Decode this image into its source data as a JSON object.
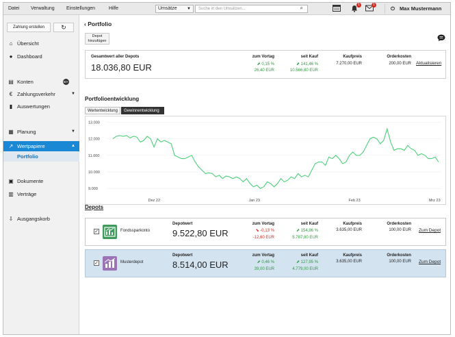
{
  "menubar": {
    "items": [
      "Datei",
      "Verwaltung",
      "Einstellungen",
      "Hilfe"
    ],
    "search_select": "Umsätze",
    "search_placeholder": "Suche in den Umsätzen...",
    "notifications_count": "1",
    "messages_count": "1",
    "user_name": "Max Mustermann"
  },
  "sidebar": {
    "zahlung_button": "Zahlung erstellen",
    "items": [
      {
        "label": "Übersicht",
        "icon": "home-icon"
      },
      {
        "label": "Dashboard",
        "icon": "dashboard-icon"
      },
      {
        "label": "Konten",
        "icon": "accounts-icon",
        "badge": "50+"
      },
      {
        "label": "Zahlungsverkehr",
        "icon": "transfer-icon"
      },
      {
        "label": "Auswertungen",
        "icon": "bar-chart-icon"
      },
      {
        "label": "Planung",
        "icon": "planning-icon"
      },
      {
        "label": "Wertpapiere",
        "icon": "stocks-icon"
      },
      {
        "label": "Dokumente",
        "icon": "documents-icon"
      },
      {
        "label": "Verträge",
        "icon": "contracts-icon"
      },
      {
        "label": "Ausgangskorb",
        "icon": "outbox-icon"
      }
    ],
    "sub_item": "Portfolio"
  },
  "main": {
    "title": "Portfolio",
    "depot_button": "Depot hinzufügen",
    "summary": {
      "label": "Gesamtwert aller Depots",
      "value": "18.036,80 EUR",
      "col_vortag": "zum Vortag",
      "col_seitkauf": "seit Kauf",
      "col_kaufpreis": "Kaufpreis",
      "col_orderkosten": "Orderkosten",
      "vortag_pct": "0,15 %",
      "vortag_eur": "26,40 EUR",
      "seitkauf_pct": "141,46 %",
      "seitkauf_eur": "10.566,80 EUR",
      "kaufpreis": "7.270,00 EUR",
      "orderkosten": "200,00 EUR",
      "refresh_link": "Aktualisieren"
    },
    "development_title": "Portfolioentwicklung",
    "tabs": [
      "Wertentwicklung",
      "Gewinnentwicklung"
    ],
    "depots_title": "Depots",
    "depots": [
      {
        "name": "Fondssparkonto",
        "value_label": "Depotwert",
        "value": "9.522,80 EUR",
        "vortag_label": "zum Vortag",
        "vortag_pct": "-0,13 %",
        "vortag_eur": "-12,60 EUR",
        "seitkauf_label": "seit Kauf",
        "seitkauf_pct": "154,96 %",
        "seitkauf_eur": "5.787,80 EUR",
        "kaufpreis_label": "Kaufpreis",
        "kaufpreis": "3.635,00 EUR",
        "orderkosten_label": "Orderkosten",
        "orderkosten": "100,00 EUR",
        "link": "Zum Depot",
        "checked": "✓"
      },
      {
        "name": "Musterdepot",
        "value_label": "Depotwert",
        "value": "8.514,00 EUR",
        "vortag_label": "zum Vortag",
        "vortag_pct": "0,46 %",
        "vortag_eur": "39,00 EUR",
        "seitkauf_label": "seit Kauf",
        "seitkauf_pct": "127,95 %",
        "seitkauf_eur": "4.779,00 EUR",
        "kaufpreis_label": "Kaufpreis",
        "kaufpreis": "3.635,00 EUR",
        "orderkosten_label": "Orderkosten",
        "orderkosten": "100,00 EUR",
        "link": "Zum Depot",
        "checked": "✓"
      }
    ]
  },
  "colors": {
    "accent": "#1a88d4",
    "positive": "#2a9d3b",
    "negative": "#d9281e",
    "line": "#4cd07a"
  },
  "chart_data": {
    "type": "line",
    "title": "",
    "xlabel": "",
    "ylabel": "",
    "x_ticks": [
      "Dez 22",
      "Jan 23",
      "Feb 23",
      "Mrz 23"
    ],
    "y_ticks": [
      "13.000",
      "12.000",
      "11.000",
      "10.000",
      "9.000"
    ],
    "ylim": [
      8800,
      13100
    ],
    "series": [
      {
        "values": [
          12000,
          12150,
          12200,
          12150,
          12200,
          12050,
          12150,
          12100,
          11800,
          11900,
          12150,
          12000,
          11500,
          12000,
          11800,
          11900,
          11800,
          11700,
          11000,
          10900,
          10800,
          10800,
          10900,
          11000,
          10600,
          10300,
          10100,
          9900,
          9950,
          9900,
          9700,
          9800,
          9600,
          9750,
          9700,
          9600,
          9700,
          9600,
          9400,
          9600,
          9300,
          9100,
          9200,
          9000,
          9100,
          9400,
          9300,
          9100,
          9300,
          9600,
          9400,
          9500,
          9700,
          9600,
          9900,
          9700,
          9800,
          9700,
          10100,
          10500,
          10600,
          10600,
          10400,
          10900,
          10800,
          11000,
          10800,
          10500,
          10600,
          11000,
          11200,
          11000,
          11000,
          11200,
          11600,
          12000,
          12100,
          12000,
          11700,
          11900,
          12600,
          11800,
          11300,
          11400,
          11400,
          11300,
          11600,
          11400,
          11300,
          11000,
          11100,
          11000,
          10800,
          10800,
          10900,
          10600
        ]
      }
    ]
  }
}
